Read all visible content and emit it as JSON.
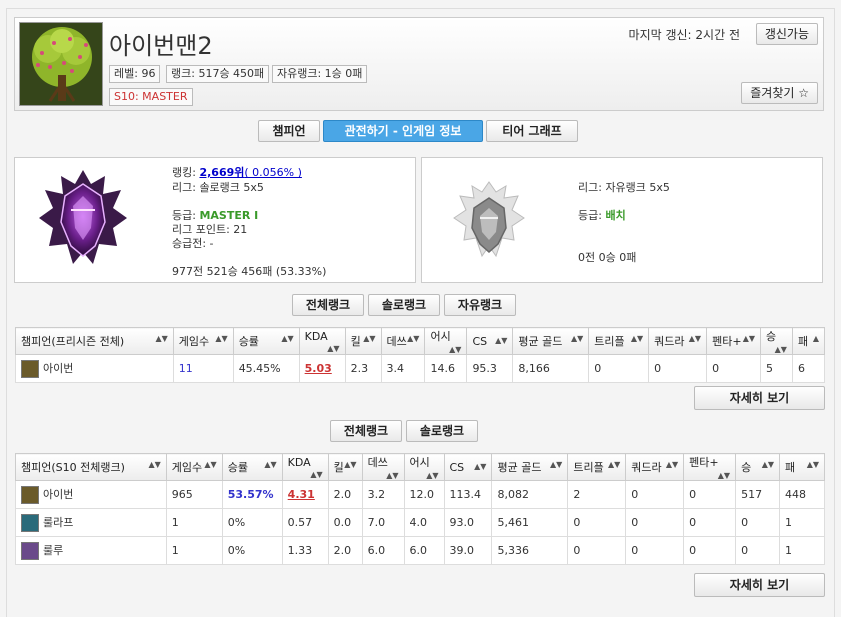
{
  "profile": {
    "username": "아이번맨2",
    "level": "레벨: 96",
    "rank_record": "랭크: 517승 450패",
    "flex_record": "자유랭크: 1승 0패",
    "season_rank": "S10: MASTER",
    "last_update": "마지막 갱신: 2시간 전",
    "update_button": "갱신가능",
    "favorite_button": "즐겨찾기 ☆"
  },
  "tabs": [
    {
      "label": "챔피언"
    },
    {
      "label": "관전하기 - 인게임 정보"
    },
    {
      "label": "티어 그래프"
    }
  ],
  "solo": {
    "ranking_label": "랭킹:",
    "ranking_value": "2,669위",
    "ranking_pct": "( 0.056% )",
    "league": "리그: 솔로랭크 5x5",
    "tier_label": "등급:",
    "tier_value": "MASTER I",
    "league_points": "리그 포인트: 21",
    "promo": "승급전: -",
    "record": "977전 521승 456패 (53.33%)"
  },
  "flex": {
    "league": "리그: 자유랭크 5x5",
    "tier_label": "등급:",
    "tier_value": "배치",
    "record": "0전 0승 0패"
  },
  "filter1": [
    "전체랭크",
    "솔로랭크",
    "자유랭크"
  ],
  "filter2": [
    "전체랭크",
    "솔로랭크"
  ],
  "table1": {
    "headers": [
      "챔피언(프리시즌 전체)",
      "게임수",
      "승률",
      "KDA",
      "킬",
      "데쓰",
      "어시",
      "CS",
      "평균 골드",
      "트리플",
      "쿼드라",
      "펜타+",
      "승",
      "패"
    ],
    "rows": [
      {
        "champ": "아이번",
        "games": "11",
        "winrate": "45.45%",
        "kda": "5.03",
        "kills": "2.3",
        "deaths": "3.4",
        "assists": "14.6",
        "cs": "95.3",
        "gold": "8,166",
        "triple": "0",
        "quadra": "0",
        "penta": "0",
        "wins": "5",
        "losses": "6"
      }
    ],
    "more": "자세히 보기"
  },
  "table2": {
    "headers": [
      "챔피언(S10 전체랭크)",
      "게임수",
      "승률",
      "KDA",
      "킬",
      "데쓰",
      "어시",
      "CS",
      "평균 골드",
      "트리플",
      "쿼드라",
      "펜타+",
      "승",
      "패"
    ],
    "rows": [
      {
        "champ": "아이번",
        "games": "965",
        "winrate": "53.57%",
        "kda": "4.31",
        "kills": "2.0",
        "deaths": "3.2",
        "assists": "12.0",
        "cs": "113.4",
        "gold": "8,082",
        "triple": "2",
        "quadra": "0",
        "penta": "0",
        "wins": "517",
        "losses": "448"
      },
      {
        "champ": "룰라프",
        "games": "1",
        "winrate": "0%",
        "kda": "0.57",
        "kills": "0.0",
        "deaths": "7.0",
        "assists": "4.0",
        "cs": "93.0",
        "gold": "5,461",
        "triple": "0",
        "quadra": "0",
        "penta": "0",
        "wins": "0",
        "losses": "1"
      },
      {
        "champ": "룰루",
        "games": "1",
        "winrate": "0%",
        "kda": "1.33",
        "kills": "2.0",
        "deaths": "6.0",
        "assists": "6.0",
        "cs": "39.0",
        "gold": "5,336",
        "triple": "0",
        "quadra": "0",
        "penta": "0",
        "wins": "0",
        "losses": "1"
      }
    ],
    "more": "자세히 보기"
  },
  "colors": {
    "accent": "#4aa6e6",
    "win_blue": "#3333cc",
    "kda_red": "#cc3333",
    "tier_green": "#3a9a2a"
  },
  "icons": {
    "avatar": "tree-avatar-icon",
    "solo_emblem": "master-emblem-icon",
    "flex_emblem": "unranked-emblem-icon"
  }
}
